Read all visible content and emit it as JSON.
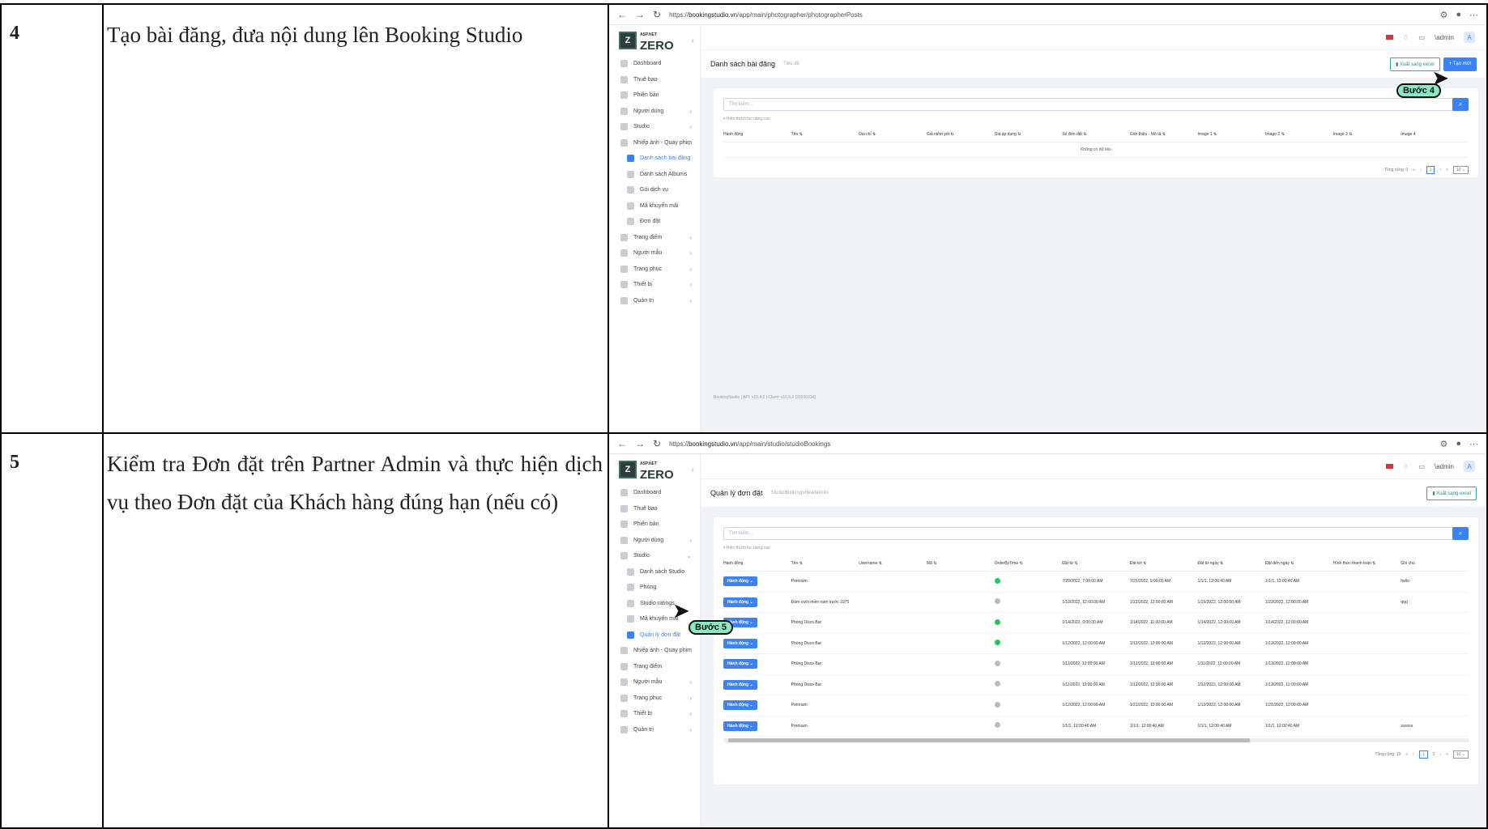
{
  "rows": [
    {
      "number": "4",
      "description": "Tạo bài đăng, đưa nội dung lên Booking Studio",
      "browser": {
        "url_prefix": "https://",
        "url_host": "bookingstudio.vn",
        "url_path": "/app/main/photographer/photographerPosts",
        "user": "\\admin",
        "avatar": "A",
        "logo_small": "ASP.NET",
        "logo_big": "ZERO",
        "menu": [
          "Dashboard",
          "Thuê bao",
          "Phiên bản",
          "Người dùng",
          "Studio",
          "Nhiếp ảnh - Quay phim",
          "Danh sách bài đăng",
          "Danh sách Albums",
          "Gói dịch vụ",
          "Mã khuyến mãi",
          "Đơn đặt",
          "Trang điểm",
          "Người mẫu",
          "Trang phục",
          "Thiết bị",
          "Quản trị"
        ],
        "page_title": "Danh sách bài đăng",
        "breadcrumb": "Tiêu đề",
        "export_label": "Xuất sang excel",
        "create_label": "Tạo mới",
        "search_placeholder": "Tìm kiếm...",
        "filter_label": "▾ Hiển thị bộ lọc nâng cao",
        "columns": [
          "Hành động",
          "Tên ⇅",
          "Địa chỉ ⇅",
          "Giá niêm yết ⇅",
          "Giá áp dụng ⇅",
          "Số đơn đặt ⇅",
          "Giới thiệu - Mô tả ⇅",
          "Image 1 ⇅",
          "Image 2 ⇅",
          "Image 3 ⇅",
          "Image 4"
        ],
        "empty_text": "Không có dữ liệu",
        "pager_total": "Tổng cộng: 0",
        "pager_page": "1",
        "pager_size": "10 ⌄",
        "footer": "BookingStudio | API: v10.4.0 | Client: v10.5.0 [20220314]"
      },
      "callout": "Bước 4"
    },
    {
      "number": "5",
      "description": "Kiểm tra Đơn đặt trên Partner Admin và thực hiện dịch vụ theo Đơn đặt của Khách hàng đúng hạn (nếu có)",
      "browser": {
        "url_prefix": "https://",
        "url_host": "bookingstudio.vn",
        "url_path": "/app/main/studio/studioBookings",
        "user": "\\admin",
        "avatar": "A",
        "logo_small": "ASP.NET",
        "logo_big": "ZERO",
        "menu": [
          "Dashboard",
          "Thuê bao",
          "Phiên bản",
          "Người dùng",
          "Studio",
          "Danh sách Studio",
          "Phòng",
          "Studio ratings",
          "Mã khuyến mãi",
          "Quản lý đơn đặt",
          "Nhiếp ảnh - Quay phim",
          "Trang điểm",
          "Người mẫu",
          "Trang phục",
          "Thiết bị",
          "Quản trị"
        ],
        "page_title": "Quản lý đơn đặt",
        "breadcrumb": "StudioBookingsHeaderInfo",
        "export_label": "Xuất sang excel",
        "search_placeholder": "Tìm kiếm...",
        "filter_label": "▾ Hiển thị bộ lọc nâng cao",
        "columns": [
          "Hành động",
          "Tên ⇅",
          "Username ⇅",
          "Mã ⇅",
          "OrderByTime ⇅",
          "Đặt từ ⇅",
          "Đặt tới ⇅",
          "Đặt từ ngày ⇅",
          "Đặt đến ngày ⇅",
          "Hình thức thanh toán ⇅",
          "Ghi chú"
        ],
        "action_label": "Hành động ⌄",
        "rows": [
          {
            "name": "Premium",
            "ok": true,
            "from": "7/20/2022, 7:00:00 AM",
            "to": "7/20/2022, 9:00:00 AM",
            "from_day": "1/1/1, 12:00:40 AM",
            "to_day": "1/1/1, 12:00:40 AM",
            "note": "hello"
          },
          {
            "name": "Đám cưới miền nam trước 1975",
            "ok": false,
            "from": "1/19/2022, 12:00:00 AM",
            "to": "1/22/2022, 12:00:00 AM",
            "from_day": "1/19/2022, 12:00:00 AM",
            "to_day": "1/22/2022, 12:00:00 AM",
            "note": "qqq"
          },
          {
            "name": "Phòng Disco Bar",
            "ok": true,
            "from": "1/14/2022, 9:00:00 AM",
            "to": "1/14/2022, 11:00:00 AM",
            "from_day": "1/14/2022, 12:00:00 AM",
            "to_day": "1/14/2022, 12:00:00 AM",
            "note": ""
          },
          {
            "name": "Phòng Disco Bar",
            "ok": true,
            "from": "1/12/2022, 12:00:00 AM",
            "to": "1/12/2022, 12:00:00 AM",
            "from_day": "1/12/2022, 12:00:00 AM",
            "to_day": "1/12/2022, 12:00:00 AM",
            "note": ""
          },
          {
            "name": "Phòng Disco Bar",
            "ok": false,
            "from": "1/11/2022, 12:00:00 AM",
            "to": "1/12/2022, 12:00:00 AM",
            "from_day": "1/11/2022, 12:00:00 AM",
            "to_day": "1/12/2022, 12:00:00 AM",
            "note": ""
          },
          {
            "name": "Phòng Disco Bar",
            "ok": false,
            "from": "1/11/2022, 12:00:00 AM",
            "to": "1/12/2022, 12:00:00 AM",
            "from_day": "1/12/2022, 12:00:00 AM",
            "to_day": "1/12/2022, 12:00:00 AM",
            "note": ""
          },
          {
            "name": "Premium",
            "ok": false,
            "from": "1/12/2022, 12:00:00 AM",
            "to": "1/21/2022, 12:00:00 AM",
            "from_day": "1/12/2022, 12:00:00 AM",
            "to_day": "1/21/2022, 12:00:00 AM",
            "note": ""
          },
          {
            "name": "Premium",
            "ok": false,
            "from": "1/1/1, 12:00:40 AM",
            "to": "1/1/1, 12:00:40 AM",
            "from_day": "1/1/1, 12:00:40 AM",
            "to_day": "1/1/1, 12:00:40 AM",
            "note": "ssssss"
          }
        ],
        "pager_total": "Tổng cộng: 15",
        "pager_pages": [
          "1",
          "2"
        ],
        "pager_size": "10 ⌄"
      },
      "callout": "Bước 5"
    }
  ]
}
